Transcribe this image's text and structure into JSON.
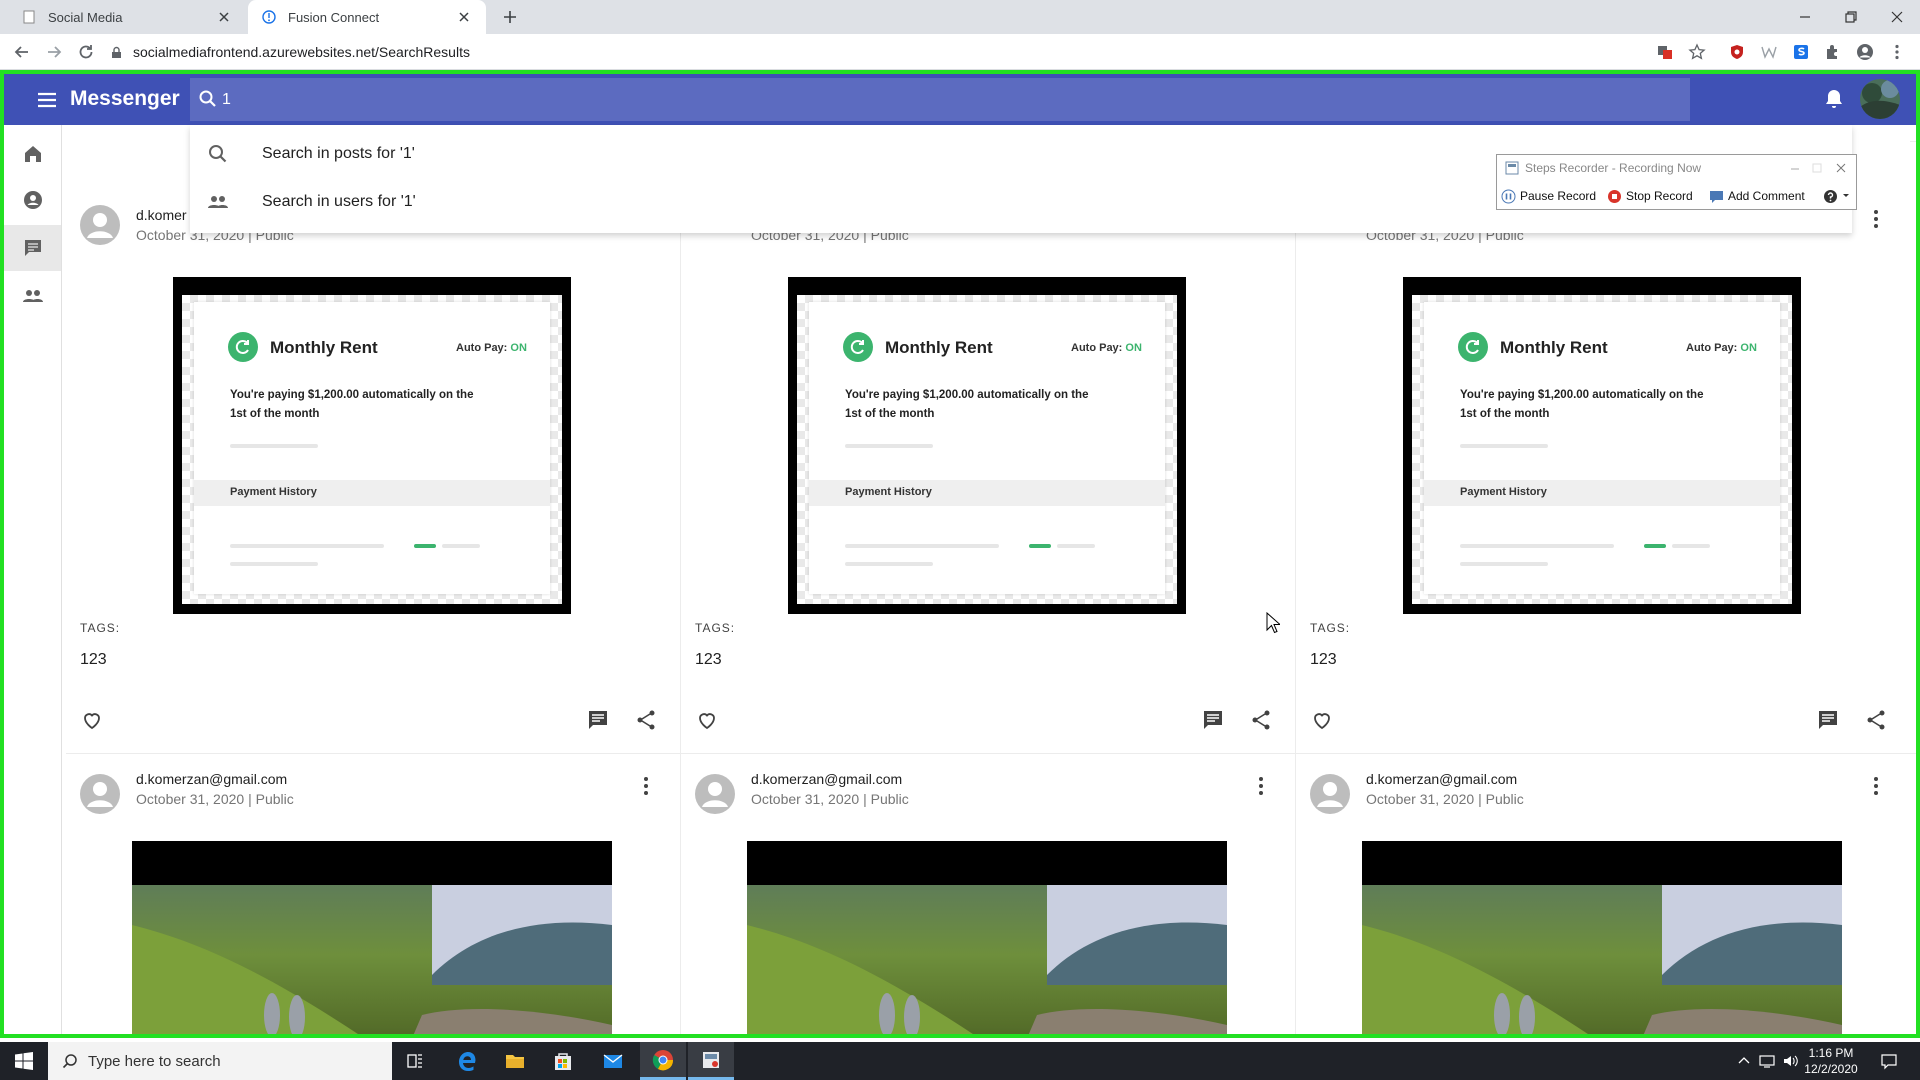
{
  "browser": {
    "tabs": [
      {
        "title": "Social Media",
        "active": false
      },
      {
        "title": "Fusion Connect",
        "active": true
      }
    ],
    "url": "socialmediafrontend.azurewebsites.net/SearchResults"
  },
  "app": {
    "title": "Messenger",
    "search_value": "1"
  },
  "search_suggestions": [
    {
      "icon": "search-icon",
      "label": "Search in posts for '1'"
    },
    {
      "icon": "people-icon",
      "label": "Search in users for '1'"
    }
  ],
  "steps_recorder": {
    "title": "Steps Recorder - Recording Now",
    "pause": "Pause Record",
    "stop": "Stop Record",
    "comment": "Add Comment"
  },
  "rent_graphic": {
    "title": "Monthly Rent",
    "autopay_label": "Auto Pay:",
    "autopay_value": "ON",
    "description": "You're paying $1,200.00 automatically on the 1st of the month",
    "history": "Payment History"
  },
  "posts_row1": [
    {
      "author": "d.komer",
      "meta": "October 31, 2020 | Public",
      "tags_label": "TAGS:",
      "tag": "123"
    },
    {
      "author": "",
      "meta": "October 31, 2020 | Public",
      "tags_label": "TAGS:",
      "tag": "123"
    },
    {
      "author": "",
      "meta": "October 31, 2020 | Public",
      "tags_label": "TAGS:",
      "tag": "123"
    }
  ],
  "posts_row2": [
    {
      "author": "d.komerzan@gmail.com",
      "meta": "October 31, 2020 | Public"
    },
    {
      "author": "d.komerzan@gmail.com",
      "meta": "October 31, 2020 | Public"
    },
    {
      "author": "d.komerzan@gmail.com",
      "meta": "October 31, 2020 | Public"
    }
  ],
  "taskbar": {
    "search_placeholder": "Type here to search",
    "time": "1:16 PM",
    "date": "12/2/2020"
  },
  "colors": {
    "appbar": "#3f51b5",
    "search_bg": "#5c6bc0",
    "recording_frame": "#22e022",
    "accent_green": "#3cb46e"
  }
}
